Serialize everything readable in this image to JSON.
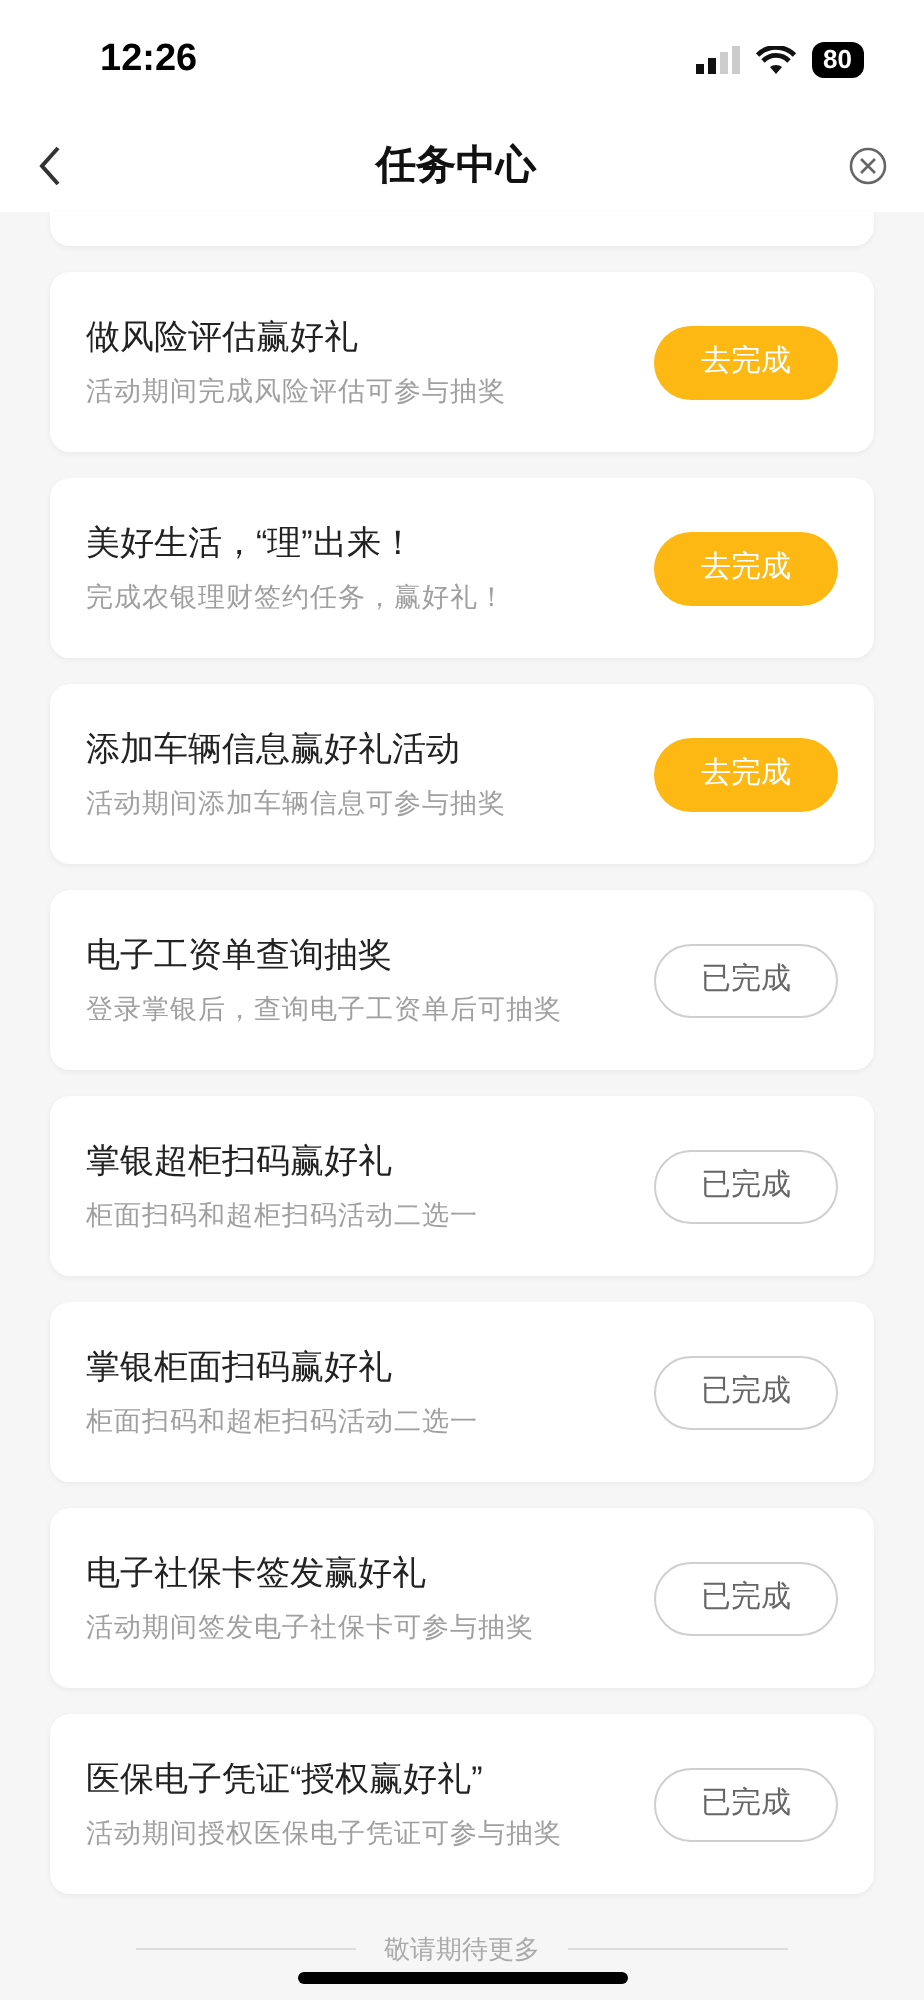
{
  "status_bar": {
    "time": "12:26",
    "battery": "80"
  },
  "nav": {
    "title": "任务中心"
  },
  "tasks": [
    {
      "title": "做风险评估赢好礼",
      "subtitle": "活动期间完成风险评估可参与抽奖",
      "button": "去完成",
      "done": false
    },
    {
      "title": "美好生活，“理”出来！",
      "subtitle": "完成农银理财签约任务，赢好礼！",
      "button": "去完成",
      "done": false
    },
    {
      "title": "添加车辆信息赢好礼活动",
      "subtitle": "活动期间添加车辆信息可参与抽奖",
      "button": "去完成",
      "done": false
    },
    {
      "title": "电子工资单查询抽奖",
      "subtitle": "登录掌银后，查询电子工资单后可抽奖",
      "button": "已完成",
      "done": true
    },
    {
      "title": "掌银超柜扫码赢好礼",
      "subtitle": "柜面扫码和超柜扫码活动二选一",
      "button": "已完成",
      "done": true
    },
    {
      "title": "掌银柜面扫码赢好礼",
      "subtitle": "柜面扫码和超柜扫码活动二选一",
      "button": "已完成",
      "done": true
    },
    {
      "title": "电子社保卡签发赢好礼",
      "subtitle": "活动期间签发电子社保卡可参与抽奖",
      "button": "已完成",
      "done": true
    },
    {
      "title": "医保电子凭证“授权赢好礼”",
      "subtitle": "活动期间授权医保电子凭证可参与抽奖",
      "button": "已完成",
      "done": true
    }
  ],
  "footer": "敬请期待更多"
}
